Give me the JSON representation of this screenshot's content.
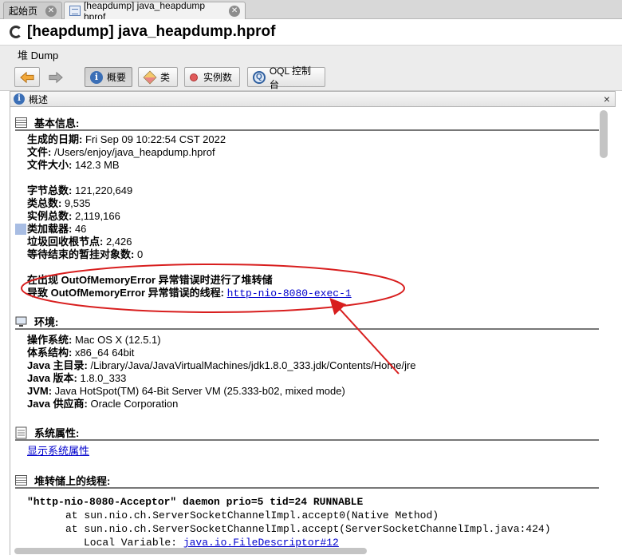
{
  "tabs": [
    {
      "label": "起始页"
    },
    {
      "label": "[heapdump] java_heapdump hprof"
    }
  ],
  "window_title": "[heapdump] java_heapdump.hprof",
  "subheader": "堆 Dump",
  "toolbar": {
    "summary_label": "概要",
    "classes_label": "类",
    "instances_label": "实例数",
    "oql_label": "OQL 控制台"
  },
  "panel": {
    "title": "概述",
    "close_glyph": "×"
  },
  "basic": {
    "heading": "基本信息:",
    "date_label": "生成的日期:",
    "date_value": " Fri Sep 09 10:22:54 CST 2022",
    "file_label": "文件:",
    "file_value": " /Users/enjoy/java_heapdump.hprof",
    "size_label": "文件大小:",
    "size_value": " 142.3 MB",
    "bytes_label": "字节总数:",
    "bytes_value": " 121,220,649",
    "classes_label": "类总数:",
    "classes_value": " 9,535",
    "instances_label": "实例总数:",
    "instances_value": " 2,119,166",
    "loaders_label": "类加载器:",
    "loaders_value": " 46",
    "gcroots_label": "垃圾回收根节点:",
    "gcroots_value": " 2,426",
    "pending_label": "等待结束的暂挂对象数:",
    "pending_value": " 0",
    "oom_line1": "在出现 OutOfMemoryError 异常错误时进行了堆转储",
    "oom_line2_label": "导致 OutOfMemoryError 异常错误的线程:",
    "oom_thread_link": "http-nio-8080-exec-1"
  },
  "env": {
    "heading": "环境:",
    "os_label": "操作系统:",
    "os_value": " Mac OS X (12.5.1)",
    "arch_label": "体系结构:",
    "arch_value": " x86_64 64bit",
    "home_label": "Java 主目录:",
    "home_value": " /Library/Java/JavaVirtualMachines/jdk1.8.0_333.jdk/Contents/Home/jre",
    "version_label": "Java 版本:",
    "version_value": " 1.8.0_333",
    "jvm_label": "JVM:",
    "jvm_value": " Java HotSpot(TM) 64-Bit Server VM (25.333-b02, mixed mode)",
    "vendor_label": "Java 供应商:",
    "vendor_value": " Oracle Corporation"
  },
  "sysprops": {
    "heading": "系统属性:",
    "link": "显示系统属性"
  },
  "threads": {
    "heading": "堆转储上的线程:",
    "lines": [
      "\"http-nio-8080-Acceptor\" daemon prio=5 tid=24 RUNNABLE",
      "at sun.nio.ch.ServerSocketChannelImpl.accept0(Native Method)",
      "at sun.nio.ch.ServerSocketChannelImpl.accept(ServerSocketChannelImpl.java:424)",
      "Local Variable: "
    ],
    "local_var_link": "java.io.FileDescriptor#12"
  },
  "colors": {
    "annotation": "#d81e1e",
    "link": "#0000cc",
    "highlight": "#a8bde3"
  }
}
